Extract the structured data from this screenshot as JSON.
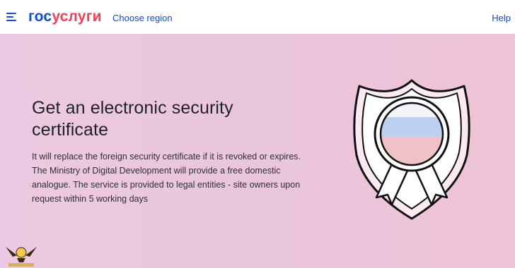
{
  "header": {
    "logo_part1": "гос",
    "logo_part2": "услуги",
    "region_link": "Choose region",
    "help_link": "Help"
  },
  "hero": {
    "title": "Get an electronic security certificate",
    "description": "It will replace the foreign security certificate if it is revoked or expires. The Ministry of Digital Development will provide a free domestic analogue. The service is provided to legal entities - site owners upon request within 5 working days"
  },
  "colors": {
    "brand_blue": "#0d4cd3",
    "brand_red": "#ee3f58",
    "hero_bg": "#ebc7df"
  },
  "icons": [
    "menu-icon",
    "certificate-badge-icon",
    "watermark-logo"
  ]
}
